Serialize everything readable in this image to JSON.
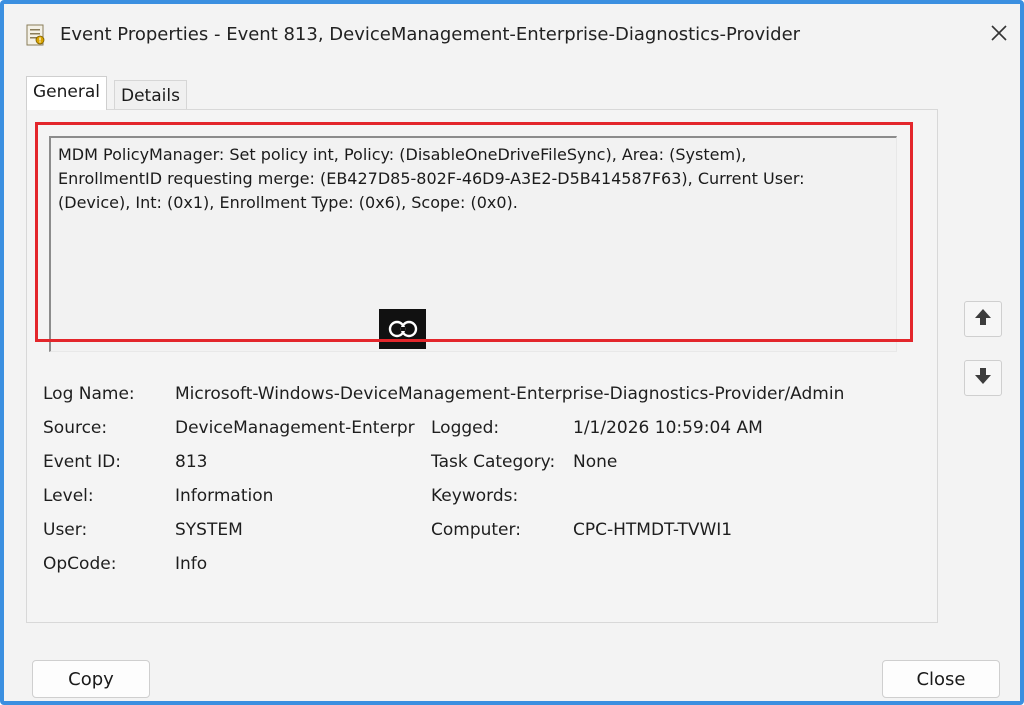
{
  "window": {
    "title": "Event Properties - Event 813, DeviceManagement-Enterprise-Diagnostics-Provider"
  },
  "tabs": [
    {
      "label": "General",
      "active": true
    },
    {
      "label": "Details",
      "active": false
    }
  ],
  "description": {
    "line1": "MDM PolicyManager: Set policy int, Policy: (DisableOneDriveFileSync), Area: (System),",
    "line2": "EnrollmentID requesting merge: (EB427D85-802F-46D9-A3E2-D5B414587F63), Current User:",
    "line3": "(Device), Int: (0x1), Enrollment Type: (0x6), Scope: (0x0)."
  },
  "fields": {
    "log_name": {
      "label": "Log Name:",
      "value": "Microsoft-Windows-DeviceManagement-Enterprise-Diagnostics-Provider/Admin"
    },
    "source": {
      "label": "Source:",
      "value": "DeviceManagement-Enterpr"
    },
    "logged": {
      "label": "Logged:",
      "value": "1/1/2026 10:59:04 AM"
    },
    "event_id": {
      "label": "Event ID:",
      "value": "813"
    },
    "task_category": {
      "label": "Task Category:",
      "value": "None"
    },
    "level": {
      "label": "Level:",
      "value": "Information"
    },
    "keywords": {
      "label": "Keywords:",
      "value": ""
    },
    "user": {
      "label": "User:",
      "value": "SYSTEM"
    },
    "computer": {
      "label": "Computer:",
      "value": "CPC-HTMDT-TVWI1"
    },
    "opcode": {
      "label": "OpCode:",
      "value": "Info"
    }
  },
  "buttons": {
    "copy": "Copy",
    "close": "Close"
  },
  "icons": {
    "app": "event-viewer-icon",
    "close": "close-icon",
    "up": "arrow-up-icon",
    "down": "arrow-down-icon"
  },
  "colors": {
    "window_border": "#3b8fe0",
    "highlight": "#e3262b",
    "background": "#f3f3f3"
  }
}
